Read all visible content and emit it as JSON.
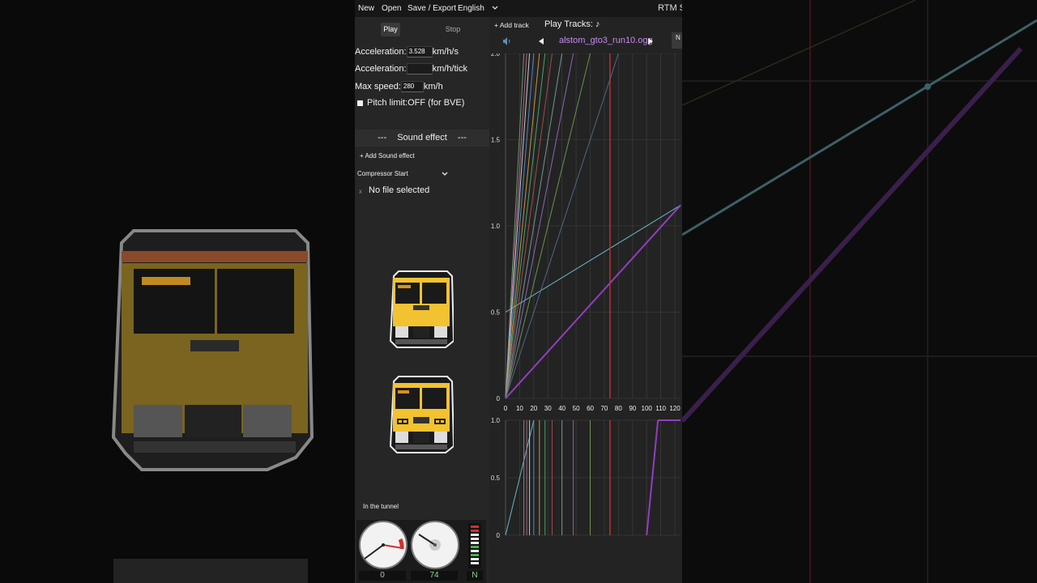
{
  "menubar": {
    "new": "New",
    "open": "Open",
    "save_export": "Save / Export",
    "language": "English",
    "app_title": "RTM S"
  },
  "controls": {
    "play": "Play",
    "stop": "Stop",
    "accel_label": "Acceleration:",
    "accel_value": "3.528",
    "accel_unit": "km/h/s",
    "accel_tick_label": "Acceleration:",
    "accel_tick_value": "",
    "accel_tick_unit": "km/h/tick",
    "max_speed_label": "Max speed:",
    "max_speed_value": "280",
    "max_speed_unit": "km/h",
    "pitch_limit": "Pitch limit:OFF (for BVE)"
  },
  "sound_effect": {
    "header_dashes_left": "---",
    "header": "Sound effect",
    "header_dashes_right": "---",
    "add": "+ Add Sound effect",
    "selected": "Compressor Start",
    "file_x": "x",
    "file_status": "No file selected"
  },
  "status": {
    "tunnel": "In the tunnel"
  },
  "gauges": {
    "speed": "0",
    "second": "74",
    "notch": "N"
  },
  "tracks": {
    "add": "+ Add track",
    "play_label": "Play Tracks:",
    "note": "♪",
    "filename": "alstom_gto3_run10.ogg",
    "side_btn": "N"
  },
  "colors": {
    "accent_purple": "#a040d0",
    "file_purple": "#c58cf0",
    "marker_red": "#d03030",
    "train_yellow": "#f2c230"
  },
  "chart_data": [
    {
      "type": "line",
      "title": "",
      "xlabel": "",
      "ylabel": "",
      "x_ticks": [
        "0",
        "10",
        "20",
        "30",
        "40",
        "50",
        "60",
        "70",
        "80",
        "90",
        "100",
        "110",
        "120"
      ],
      "y_ticks": [
        "0",
        "0.5",
        "1.0",
        "1.5",
        "2.0"
      ],
      "xlim": [
        0,
        124
      ],
      "ylim": [
        0,
        2.0
      ],
      "grid": true,
      "series": [
        {
          "color": "#70c8d8",
          "x": [
            0,
            124
          ],
          "y": [
            0.5,
            1.12
          ]
        },
        {
          "color": "#a040d0",
          "x": [
            0,
            124
          ],
          "y": [
            0,
            1.12
          ]
        },
        {
          "color": "#d03030",
          "x": [
            74,
            74
          ],
          "y": [
            0,
            2.0
          ]
        },
        {
          "color": "#6fa86f",
          "x": [
            0,
            13
          ],
          "y": [
            0,
            2.0
          ]
        },
        {
          "color": "#c06aa0",
          "x": [
            0,
            15
          ],
          "y": [
            0,
            2.0
          ]
        },
        {
          "color": "#d8d8d8",
          "x": [
            0,
            17
          ],
          "y": [
            0,
            2.0
          ]
        },
        {
          "color": "#5a8fd0",
          "x": [
            0,
            20
          ],
          "y": [
            0,
            2.0
          ]
        },
        {
          "color": "#d8a040",
          "x": [
            0,
            24
          ],
          "y": [
            0,
            2.0
          ]
        },
        {
          "color": "#50b070",
          "x": [
            0,
            28
          ],
          "y": [
            0,
            2.0
          ]
        },
        {
          "color": "#b05050",
          "x": [
            0,
            33
          ],
          "y": [
            0,
            2.0
          ]
        },
        {
          "color": "#80a0a0",
          "x": [
            0,
            40
          ],
          "y": [
            0,
            2.0
          ]
        },
        {
          "color": "#9070c0",
          "x": [
            0,
            48
          ],
          "y": [
            0,
            2.0
          ]
        },
        {
          "color": "#70a050",
          "x": [
            0,
            60
          ],
          "y": [
            0,
            2.0
          ]
        },
        {
          "color": "#507090",
          "x": [
            0,
            80
          ],
          "y": [
            0,
            2.0
          ]
        }
      ]
    },
    {
      "type": "line",
      "title": "",
      "y_ticks": [
        "0",
        "0.5",
        "1.0"
      ],
      "xlim": [
        0,
        124
      ],
      "ylim": [
        0,
        1.0
      ],
      "grid": true,
      "series": [
        {
          "color": "#70c8d8",
          "x": [
            0,
            20
          ],
          "y": [
            0,
            1.0
          ]
        },
        {
          "color": "#a040d0",
          "x": [
            100,
            108
          ],
          "y": [
            0,
            1.0
          ]
        },
        {
          "color": "#a040d0",
          "x": [
            108,
            124
          ],
          "y": [
            1.0,
            1.0
          ]
        },
        {
          "color": "#d03030",
          "x": [
            74,
            74
          ],
          "y": [
            0,
            1.0
          ]
        },
        {
          "color": "#6fa86f",
          "x": [
            13,
            13
          ],
          "y": [
            0,
            1.0
          ]
        },
        {
          "color": "#c06aa0",
          "x": [
            15,
            15
          ],
          "y": [
            0,
            1.0
          ]
        },
        {
          "color": "#d8d8d8",
          "x": [
            17,
            17
          ],
          "y": [
            0,
            1.0
          ]
        },
        {
          "color": "#5a8fd0",
          "x": [
            20,
            20
          ],
          "y": [
            0,
            1.0
          ]
        },
        {
          "color": "#d8a040",
          "x": [
            24,
            24
          ],
          "y": [
            0,
            1.0
          ]
        },
        {
          "color": "#50b070",
          "x": [
            28,
            28
          ],
          "y": [
            0,
            1.0
          ]
        },
        {
          "color": "#b05050",
          "x": [
            33,
            33
          ],
          "y": [
            0,
            1.0
          ]
        },
        {
          "color": "#80a0a0",
          "x": [
            40,
            40
          ],
          "y": [
            0,
            1.0
          ]
        },
        {
          "color": "#9070c0",
          "x": [
            48,
            48
          ],
          "y": [
            0,
            1.0
          ]
        },
        {
          "color": "#70a050",
          "x": [
            60,
            60
          ],
          "y": [
            0,
            1.0
          ]
        }
      ]
    }
  ]
}
